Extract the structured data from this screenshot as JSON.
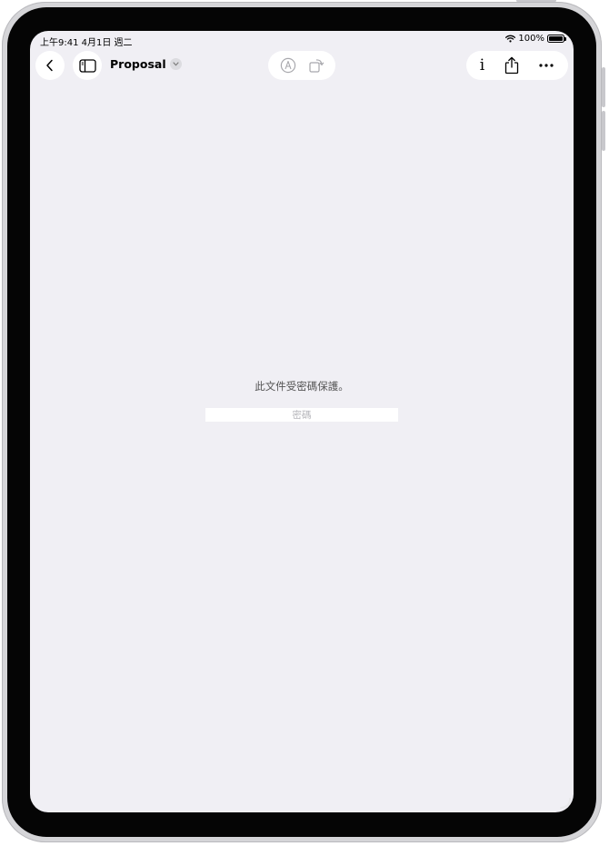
{
  "status_bar": {
    "time_date": "上午9:41  4月1日 週二",
    "battery_percent": "100%",
    "battery_level": 1.0
  },
  "toolbar": {
    "document_title": "Proposal",
    "icons": {
      "back": "chevron-left-icon",
      "sidebar": "sidebar-icon",
      "title_menu": "chevron-down-icon",
      "markup": "markup-pen-icon",
      "rotate": "rotate-icon",
      "info": "info-icon",
      "share": "share-icon",
      "more": "more-icon"
    }
  },
  "content": {
    "message": "此文件受密碼保護。",
    "password_placeholder": "密碼",
    "password_value": ""
  },
  "colors": {
    "screen_background": "#f0eff4",
    "button_background": "#ffffff",
    "disabled_icon": "#a8a8ad"
  }
}
